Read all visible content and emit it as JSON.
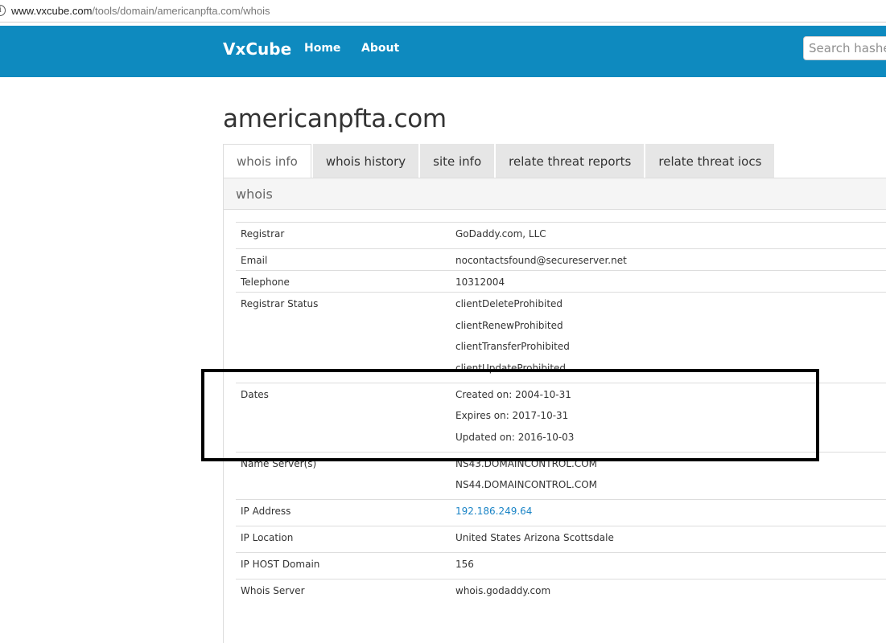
{
  "browser": {
    "url_host": "www.vxcube.com",
    "url_path": "/tools/domain/americanpfta.com/whois",
    "info_icon": "info-icon"
  },
  "navbar": {
    "brand": "VxCube",
    "links": [
      "Home",
      "About"
    ],
    "search_placeholder": "Search hashes"
  },
  "page": {
    "title": "americanpfta.com"
  },
  "tabs": [
    "whois info",
    "whois history",
    "site info",
    "relate threat reports",
    "relate threat iocs"
  ],
  "active_tab": "whois info",
  "panel": {
    "heading": "whois"
  },
  "whois": {
    "rows": [
      {
        "key": "Registrar",
        "values": [
          "GoDaddy.com, LLC"
        ]
      },
      {
        "key": "Email",
        "values": [
          "nocontactsfound@secureserver.net"
        ]
      },
      {
        "key": "Telephone",
        "values": [
          "10312004"
        ]
      },
      {
        "key": "Registrar Status",
        "values": [
          "clientDeleteProhibited",
          "clientRenewProhibited",
          "clientTransferProhibited",
          "clientUpdateProhibited"
        ]
      },
      {
        "key": "Dates",
        "values": [
          "Created on: 2004-10-31",
          "Expires on: 2017-10-31",
          "Updated on: 2016-10-03"
        ]
      },
      {
        "key": "Name Server(s)",
        "values": [
          "NS43.DOMAINCONTROL.COM",
          "NS44.DOMAINCONTROL.COM"
        ]
      },
      {
        "key": "IP Address",
        "values": [
          "192.186.249.64"
        ],
        "link": true
      },
      {
        "key": "IP Location",
        "values": [
          "United States Arizona Scottsdale"
        ]
      },
      {
        "key": "IP HOST Domain",
        "values": [
          "156"
        ]
      },
      {
        "key": "Whois Server",
        "values": [
          "whois.godaddy.com"
        ]
      }
    ]
  },
  "colors": {
    "navbar": "#0e8abf",
    "link": "#1a84c6",
    "highlight_border": "#000000"
  }
}
